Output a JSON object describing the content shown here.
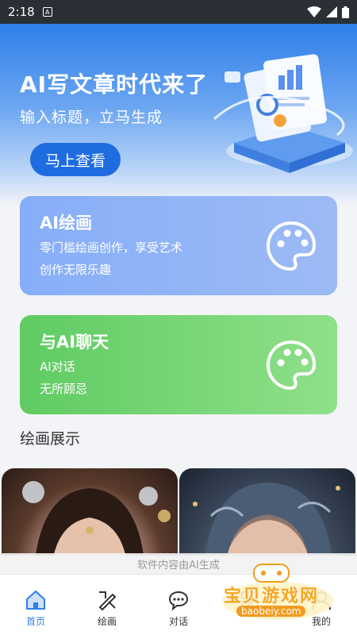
{
  "status_bar": {
    "time": "2:18",
    "notification_glyph": "A"
  },
  "hero": {
    "title": "AI写文章时代来了",
    "subtitle": "输入标题，立马生成",
    "button_label": "马上查看"
  },
  "cards": {
    "draw": {
      "title": "AI绘画",
      "line1": "零门槛绘画创作，享受艺术",
      "line2": "创作无限乐趣"
    },
    "chat": {
      "title": "与AI聊天",
      "line1": "AI对话",
      "line2": "无所顾忌"
    }
  },
  "section": {
    "title": "绘画展示"
  },
  "notice": "软件内容由AI生成",
  "tabs": [
    {
      "label": "首页",
      "icon": "home-icon"
    },
    {
      "label": "绘画",
      "icon": "paint-icon"
    },
    {
      "label": "对话",
      "icon": "chat-icon"
    },
    {
      "label": "",
      "icon": "category-icon"
    },
    {
      "label": "我的",
      "icon": "user-icon"
    }
  ],
  "watermark": {
    "brand": "宝贝游戏网",
    "url": "baobeiy.com"
  },
  "colors": {
    "accent": "#2f7fe8",
    "draw_card": "#8fb3f6",
    "chat_card": "#6fd06c"
  }
}
